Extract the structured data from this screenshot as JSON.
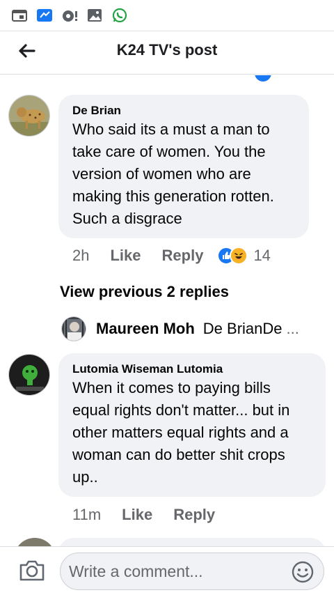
{
  "status_bar": {
    "icons": [
      "calendar-icon",
      "messenger-icon",
      "camera-notification-icon",
      "gallery-icon",
      "whatsapp-icon"
    ]
  },
  "header": {
    "title": "K24 TV's post",
    "back_icon": "arrow-left-icon"
  },
  "colors": {
    "like_blue": "#1877f2",
    "haha_yellow": "#f7b125",
    "secondary_text": "#65676b",
    "bubble_bg": "#f0f2f5"
  },
  "comments": [
    {
      "author": "De Brian",
      "text": "Who said its a must a man to take care of women. You the version of women who are making this generation rotten. Such a disgrace",
      "time": "2h",
      "like_label": "Like",
      "reply_label": "Reply",
      "reactions": [
        "like",
        "haha"
      ],
      "reaction_count": "14"
    },
    {
      "author": "Lutomia Wiseman Lutomia",
      "text": "When it comes to paying bills equal rights don't matter... but in other matters equal rights and a  woman can do better shit crops up..",
      "time": "11m",
      "like_label": "Like",
      "reply_label": "Reply"
    }
  ],
  "view_previous": "View previous 2 replies",
  "reply_preview": {
    "author": "Maureen Moh",
    "text": "De BrianDe",
    "more": "..."
  },
  "composer": {
    "placeholder": "Write a comment...",
    "camera_icon": "camera-icon",
    "emoji_icon": "emoji-icon"
  }
}
